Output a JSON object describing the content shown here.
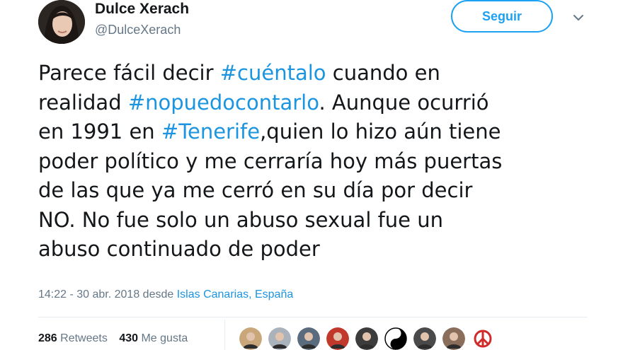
{
  "user": {
    "display_name": "Dulce Xerach",
    "handle": "@DulceXerach",
    "follow_label": "Seguir"
  },
  "tweet": {
    "lines": [
      [
        {
          "t": "Parece fácil decir ",
          "tag": false
        },
        {
          "t": "#cuéntalo",
          "tag": true
        },
        {
          "t": " cuando en",
          "tag": false
        }
      ],
      [
        {
          "t": "realidad ",
          "tag": false
        },
        {
          "t": "#nopuedocontarlo",
          "tag": true
        },
        {
          "t": ". Aunque ocurrió",
          "tag": false
        }
      ],
      [
        {
          "t": "en 1991 en ",
          "tag": false
        },
        {
          "t": "#Tenerife",
          "tag": true
        },
        {
          "t": ",quien lo hizo aún tiene",
          "tag": false
        }
      ],
      [
        {
          "t": "poder político y me cerraría hoy más puertas",
          "tag": false
        }
      ],
      [
        {
          "t": "de las que ya me cerró en su día por decir",
          "tag": false
        }
      ],
      [
        {
          "t": "NO. No fue solo un abuso sexual fue un",
          "tag": false
        }
      ],
      [
        {
          "t": "abuso continuado de poder",
          "tag": false
        }
      ]
    ],
    "timestamp": "14:22 - 30 abr. 2018 desde ",
    "location_1": "Islas Canarias",
    "location_sep": ", ",
    "location_2": "España"
  },
  "stats": {
    "retweets_count": "286",
    "retweets_label": "Retweets",
    "likes_count": "430",
    "likes_label": "Me gusta"
  },
  "likers": [
    {
      "icon": "liker-avatar-1",
      "color": "#c9a77a"
    },
    {
      "icon": "liker-avatar-2",
      "color": "#aab3bb"
    },
    {
      "icon": "liker-avatar-3",
      "color": "#5a6b7e"
    },
    {
      "icon": "liker-avatar-4",
      "color": "#c0392b"
    },
    {
      "icon": "liker-avatar-5",
      "color": "#3c3c3c"
    },
    {
      "icon": "yin-yang-avatar",
      "color": "#000000"
    },
    {
      "icon": "liker-avatar-7",
      "color": "#4a4a4a"
    },
    {
      "icon": "liker-avatar-8",
      "color": "#8a6d5a"
    },
    {
      "icon": "peace-sign-avatar",
      "color": "#d12a2a"
    }
  ],
  "colors": {
    "accent": "#1da1f2",
    "link": "#1b95e0",
    "muted": "#657786",
    "text": "#14171a"
  }
}
